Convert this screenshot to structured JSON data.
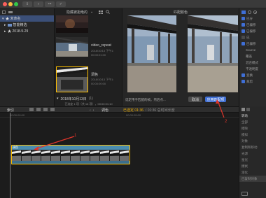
{
  "toolbar": {
    "buttons": [
      "⇩",
      "♀",
      "⊶",
      "✓"
    ]
  },
  "library": {
    "items": [
      {
        "label": "未命名",
        "selected": true
      },
      {
        "label": "智能精选",
        "selected": false
      },
      {
        "label": "2018-9-29",
        "selected": false
      }
    ]
  },
  "browser": {
    "header": "隐藏被拒绝的",
    "clips": [
      {
        "name": "",
        "meta": [
          "",
          ""
        ]
      },
      {
        "name": "video_repeat",
        "meta": [
          "2018/10/13 下午1:",
          "00:00:01:00"
        ]
      },
      {
        "name": "调色",
        "meta": [
          "2018/10/13 下午1:",
          "00:00:00:00"
        ]
      }
    ],
    "date_group": "2018年10月13日",
    "date_count": "(1)",
    "status": "已选定 1 项（共 16 项），00:00:01:10"
  },
  "viewer": {
    "title": "匹配颜色",
    "hint": "选定用于匹配的帧。然后点...",
    "cancel_label": "取消",
    "apply_label": "应用匹配项"
  },
  "inspector": {
    "rows": [
      {
        "label": "已分",
        "checked": true
      },
      {
        "label": "已偏移",
        "checked": true
      },
      {
        "label": "已偏移",
        "checked": true
      },
      {
        "label": "已",
        "checked": false
      },
      {
        "label": "已偏移",
        "checked": true
      },
      {
        "label": "Source",
        "checked": false
      },
      {
        "label": "覆盖",
        "checked": false
      },
      {
        "label": "混合模式",
        "checked": false
      },
      {
        "label": "不透明度",
        "checked": false
      },
      {
        "label": "变换",
        "checked": true
      },
      {
        "label": "裁剪",
        "checked": true
      }
    ]
  },
  "timeline": {
    "index_label": "索引",
    "clip_label": "调色",
    "duration_selected": "已选定 01:36",
    "duration_total": "/ 01:36 总时间长度",
    "ruler_marks": [
      "00:00:00:00",
      "00:00:05:00"
    ],
    "clip_name": "调色"
  },
  "effects": {
    "header": "转场",
    "rows": [
      "全部",
      "擦除",
      "模拟",
      "对象",
      "复制和移动",
      "光源",
      "星光",
      "擦拭",
      "溶化",
      "已复制对象"
    ]
  },
  "annotations": [
    "1",
    "2"
  ],
  "colors": {
    "accent": "#3f6fd6",
    "clip": "#4a8db0",
    "selection": "#ffc000",
    "arrow": "#e0352b"
  }
}
